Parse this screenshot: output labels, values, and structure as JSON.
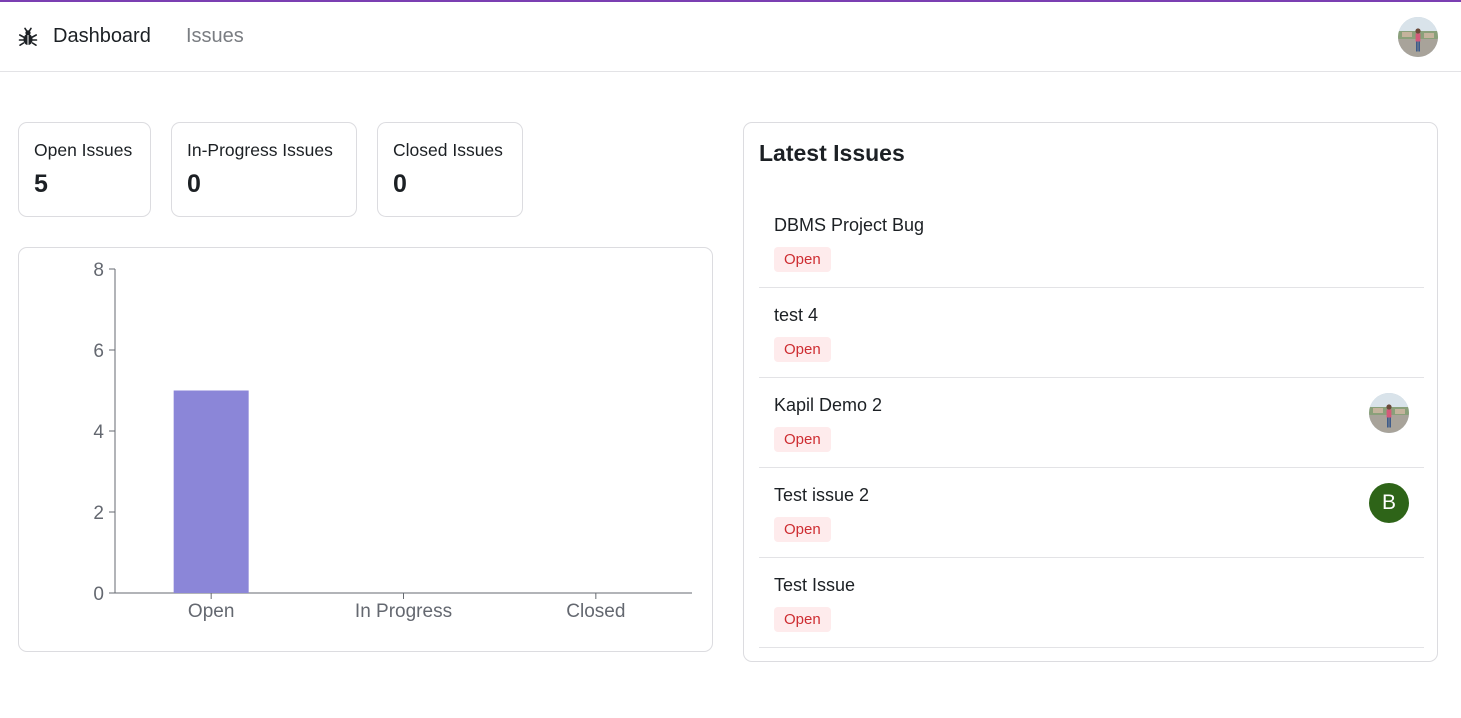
{
  "nav": {
    "links": [
      {
        "label": "Dashboard",
        "active": true
      },
      {
        "label": "Issues",
        "active": false
      }
    ],
    "logo_icon": "bug-icon",
    "avatar_icon": "user-avatar-photo"
  },
  "colors": {
    "accent": "#7b3fb2",
    "bar": "#8b86d8",
    "open_badge_text": "#ce2c31",
    "open_badge_bg": "#feebec",
    "letter_avatar_bg": "#2e6418"
  },
  "summary": [
    {
      "label": "Open Issues",
      "value": "5"
    },
    {
      "label": "In-Progress Issues",
      "value": "0"
    },
    {
      "label": "Closed Issues",
      "value": "0"
    }
  ],
  "chart_data": {
    "type": "bar",
    "categories": [
      "Open",
      "In Progress",
      "Closed"
    ],
    "values": [
      5,
      0,
      0
    ],
    "ylim": [
      0,
      8
    ],
    "yticks": [
      0,
      2,
      4,
      6,
      8
    ],
    "title": "",
    "xlabel": "",
    "ylabel": "",
    "grid": false,
    "color": "#8b86d8"
  },
  "latest": {
    "title": "Latest Issues",
    "issues": [
      {
        "title": "DBMS Project Bug",
        "status": "Open",
        "assignee": ""
      },
      {
        "title": "test 4",
        "status": "Open",
        "assignee": ""
      },
      {
        "title": "Kapil Demo 2",
        "status": "Open",
        "assignee": "photo"
      },
      {
        "title": "Test issue 2",
        "status": "Open",
        "assignee": "B"
      },
      {
        "title": "Test Issue",
        "status": "Open",
        "assignee": ""
      }
    ]
  }
}
